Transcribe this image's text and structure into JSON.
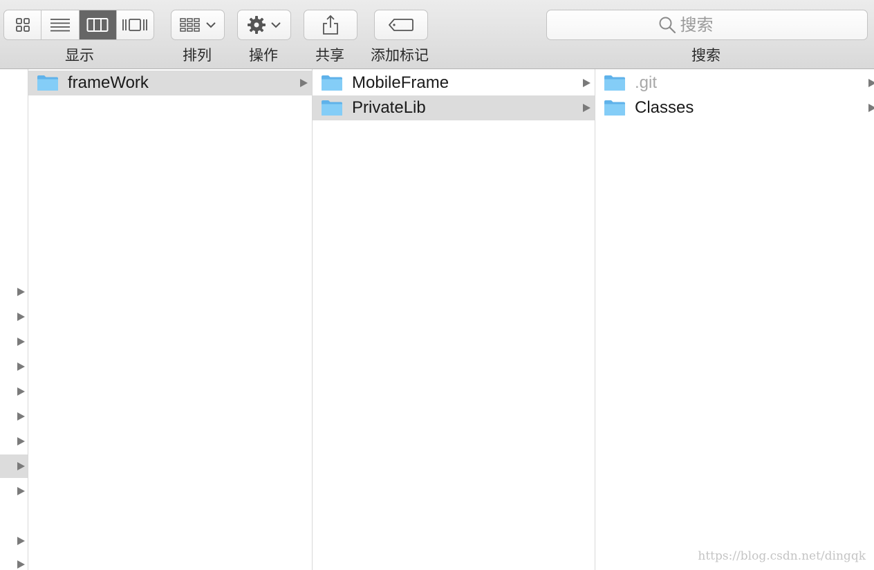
{
  "toolbar": {
    "view_label": "显示",
    "arrange_label": "排列",
    "action_label": "操作",
    "share_label": "共享",
    "tag_label": "添加标记",
    "search_label": "搜索",
    "search_placeholder": "搜索",
    "active_view": "column"
  },
  "columns": [
    {
      "items": [
        {
          "name": "frameWork",
          "selected": true,
          "hidden": false
        }
      ]
    },
    {
      "items": [
        {
          "name": "MobileFrame",
          "selected": false,
          "hidden": false
        },
        {
          "name": "PrivateLib",
          "selected": true,
          "hidden": false
        }
      ]
    },
    {
      "items": [
        {
          "name": ".git",
          "selected": false,
          "hidden": true
        },
        {
          "name": "Classes",
          "selected": false,
          "hidden": false
        }
      ]
    }
  ],
  "colors": {
    "folder": "#7cc8f5",
    "selection": "#dcdcdc",
    "active_segment": "#666666"
  },
  "watermark": "https://blog.csdn.net/dingqk"
}
